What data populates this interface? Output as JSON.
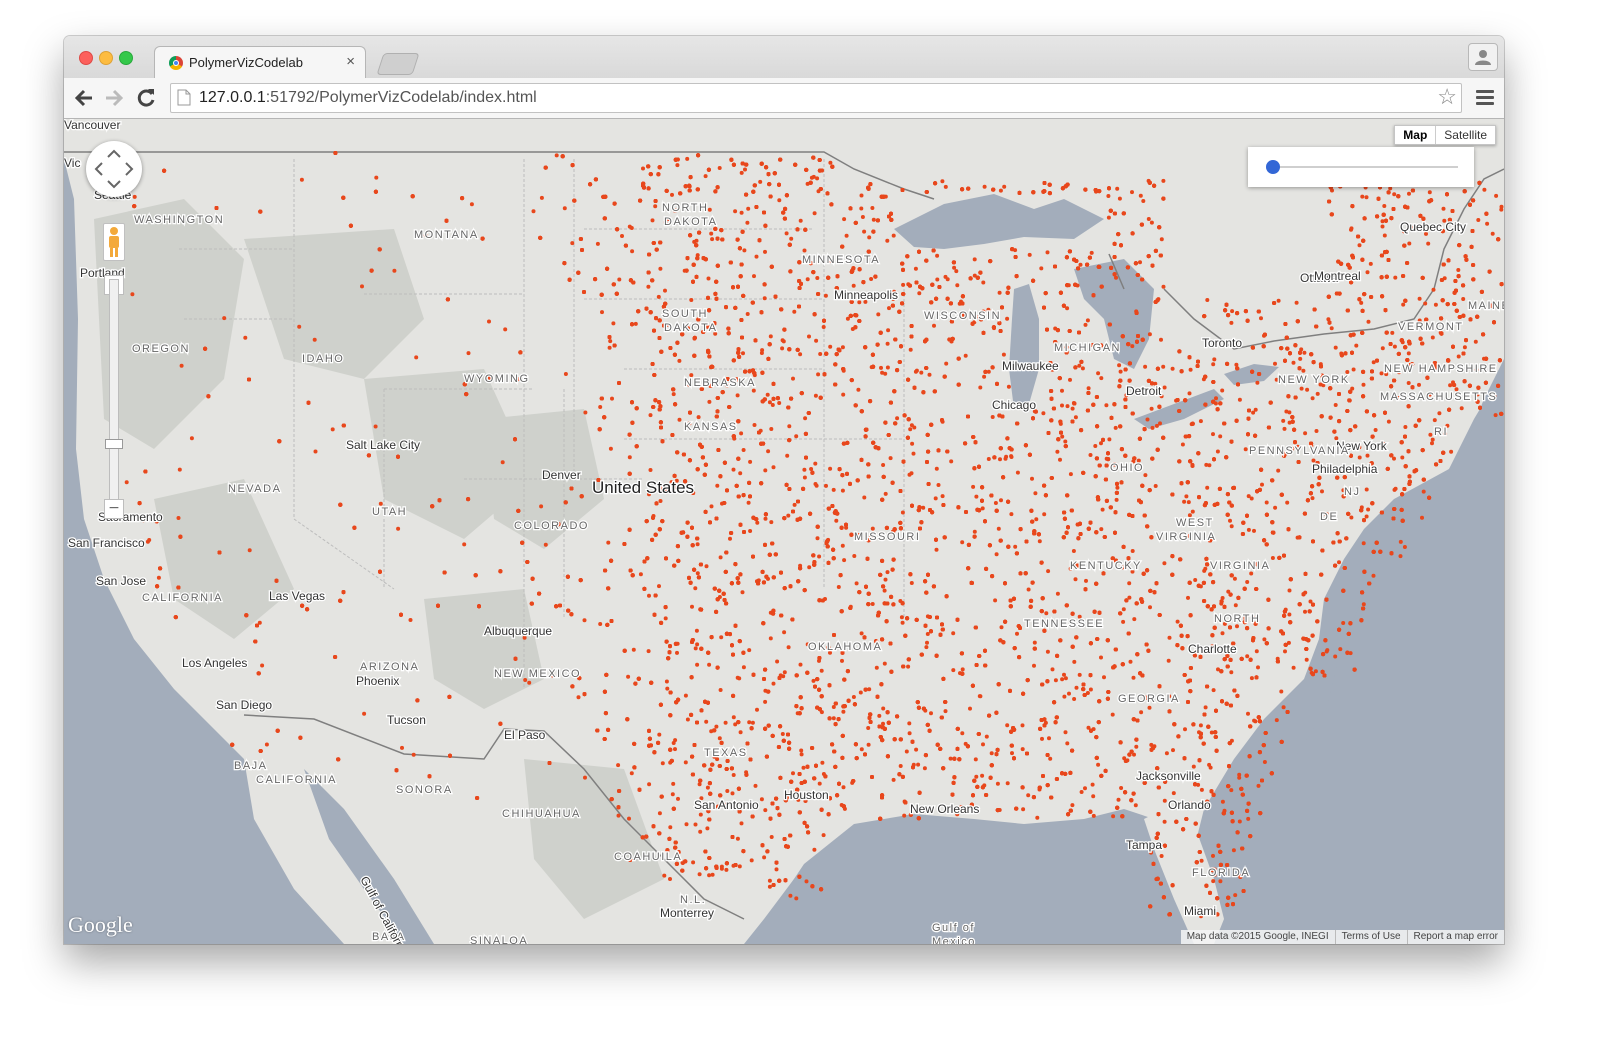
{
  "browser": {
    "tab_title": "PolymerVizCodelab",
    "tab_close": "×",
    "url_host": "127.0.0.1",
    "url_rest": ":51792/PolymerVizCodelab/index.html",
    "star_icon": "☆"
  },
  "map": {
    "map_type": {
      "map_label": "Map",
      "satellite_label": "Satellite",
      "selected": "Map"
    },
    "slider_value": 0,
    "zoom": {
      "in": "+",
      "out": "−"
    },
    "google_logo": "Google",
    "attribution": {
      "data": "Map data ©2015 Google, INEGI",
      "terms": "Terms of Use",
      "report": "Report a map error"
    },
    "dot_color": "#e8471c",
    "colors": {
      "water": "#a3adbb",
      "land": "#e4e4e1"
    },
    "labels": [
      "Vancouver",
      "Vic",
      "Seattle",
      "WASHINGTON",
      "Portland",
      "OREGON",
      "IDAHO",
      "MONTANA",
      "WYOMING",
      "Salt Lake City",
      "NEVADA",
      "UTAH",
      "COLORADO",
      "Sacramento",
      "San Francisco",
      "San Jose",
      "CALIFORNIA",
      "Las Vegas",
      "Los Angeles",
      "San Diego",
      "ARIZONA",
      "Phoenix",
      "Tucson",
      "Albuquerque",
      "NEW MEXICO",
      "El Paso",
      "BAJA",
      "CALIFORNIA",
      "SONORA",
      "CHIHUAHUA",
      "COAHUILA",
      "Monterrey",
      "N.L.",
      "SINALOA",
      "BAJA",
      "Gulf of California",
      "NORTH",
      "DAKOTA",
      "SOUTH",
      "DAKOTA",
      "MINNESOTA",
      "Minneapolis",
      "WISCONSIN",
      "Milwaukee",
      "MICHIGAN",
      "Chicago",
      "Detroit",
      "Toronto",
      "Ottawa",
      "Montreal",
      "Quebec City",
      "MAINE",
      "VERMONT",
      "NEW HAMPSHIRE",
      "MASSACHUSETTS",
      "NEW YORK",
      "RI",
      "New York",
      "Philadelphia",
      "PENNSYLVANIA",
      "NJ",
      "DE",
      "WEST",
      "VIRGINIA",
      "VIRGINIA",
      "NORTH",
      "Charlotte",
      "OHIO",
      "MISSOURI",
      "KENTUCKY",
      "TENNESSEE",
      "TEXAS",
      "San Antonio",
      "Houston",
      "New Orleans",
      "Jacksonville",
      "Orlando",
      "Tampa",
      "FLORIDA",
      "Miami",
      "Gulf of",
      "Mexico",
      "Denver",
      "United States",
      "KANSAS",
      "NEBRASKA",
      "OKLAHOMA",
      "GEORGIA"
    ]
  }
}
